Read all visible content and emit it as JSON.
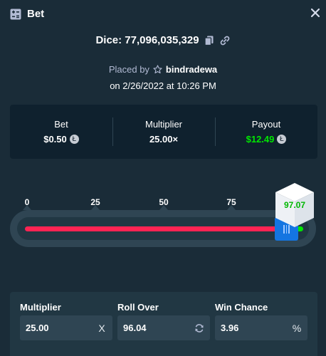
{
  "header": {
    "title": "Bet",
    "close_icon": "close-icon",
    "bet_icon": "bet-slip-icon"
  },
  "bet": {
    "dice_title": "Dice: 77,096,035,329",
    "placed_by_label": "Placed by",
    "username": "bindradewa",
    "date": "on 2/26/2022 at 10:26 PM"
  },
  "stats": {
    "bet_label": "Bet",
    "bet_value": "$0.50",
    "multiplier_label": "Multiplier",
    "multiplier_value": "25.00×",
    "payout_label": "Payout",
    "payout_value": "$12.49",
    "payout_color": "#00e701"
  },
  "slider": {
    "ticks": [
      "0",
      "25",
      "50",
      "75"
    ],
    "result": "97.07",
    "roll_over": 96.04,
    "lose_color": "#ff2453",
    "win_color": "#00e701",
    "handle_color": "#1475e1"
  },
  "fields": {
    "multiplier_label": "Multiplier",
    "multiplier_value": "25.00",
    "multiplier_suffix": "X",
    "roll_over_label": "Roll Over",
    "roll_over_value": "96.04",
    "win_chance_label": "Win Chance",
    "win_chance_value": "3.96",
    "win_chance_suffix": "%"
  }
}
